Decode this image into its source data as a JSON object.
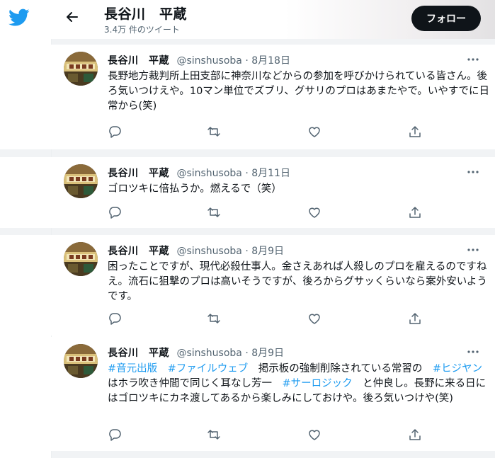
{
  "header": {
    "name": "長谷川　平蔵",
    "tweet_count": "3.4万 件のツイート",
    "follow_label": "フォロー"
  },
  "tweets": [
    {
      "name": "長谷川　平蔵",
      "handle": "@sinshusoba",
      "date": "8月18日",
      "segments": [
        {
          "text": "長野地方裁判所上田支部に神奈川などからの参加を呼びかけられている皆さん。後ろ気いつけえや。10マン単位でズブリ、グサリのプロはあまたやで。いやすでに日常から(笑)",
          "hashtag": false
        }
      ]
    },
    {
      "name": "長谷川　平蔵",
      "handle": "@sinshusoba",
      "date": "8月11日",
      "segments": [
        {
          "text": "ゴロツキに倍払うか。燃えるで（笑）",
          "hashtag": false
        }
      ]
    },
    {
      "name": "長谷川　平蔵",
      "handle": "@sinshusoba",
      "date": "8月9日",
      "segments": [
        {
          "text": "困ったことですが、現代必殺仕事人。金さえあれば人殺しのプロを雇えるのですねえ。流石に狙撃のプロは高いそうですが、後ろからグサッくらいなら案外安いようです。",
          "hashtag": false
        }
      ]
    },
    {
      "name": "長谷川　平蔵",
      "handle": "@sinshusoba",
      "date": "8月9日",
      "segments": [
        {
          "text": "#音元出版",
          "hashtag": true
        },
        {
          "text": "　",
          "hashtag": false
        },
        {
          "text": "#ファイルウェブ",
          "hashtag": true
        },
        {
          "text": "　掲示板の強制削除されている常習の　",
          "hashtag": false
        },
        {
          "text": "#ヒジヤン",
          "hashtag": true
        },
        {
          "text": "　はホラ吹き仲間で同じく耳なし芳一　",
          "hashtag": false
        },
        {
          "text": "#サーロジック",
          "hashtag": true
        },
        {
          "text": "　と仲良し。長野に来る日にはゴロツキにカネ渡してあるから楽しみにしておけや。後ろ気いつけや(笑)",
          "hashtag": false
        }
      ]
    }
  ],
  "colors": {
    "accent": "#1d9bf0",
    "text": "#0f1419",
    "muted": "#536471",
    "follow_bg": "#0f1419"
  },
  "icons": [
    "twitter-bird-icon",
    "back-arrow-icon",
    "more-icon",
    "reply-icon",
    "retweet-icon",
    "like-icon",
    "share-icon"
  ]
}
